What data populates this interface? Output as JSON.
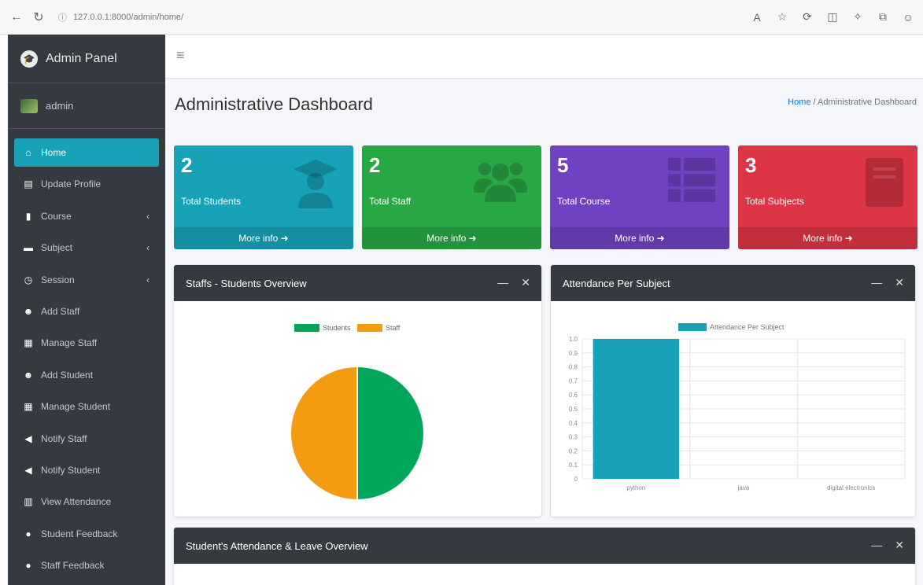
{
  "browser": {
    "url": "127.0.0.1:8000/admin/home/",
    "icons": [
      "read-aloud-icon",
      "favorite-star-icon",
      "refresh-icon",
      "split-screen-icon",
      "extensions-icon",
      "collections-icon",
      "profile-icon"
    ]
  },
  "sidebar": {
    "brand": "Admin Panel",
    "user": "admin",
    "items": [
      {
        "label": "Home",
        "icon": "home-icon",
        "active": true
      },
      {
        "label": "Update Profile",
        "icon": "id-card-icon"
      },
      {
        "label": "Course",
        "icon": "bookmark-icon",
        "chevron": true
      },
      {
        "label": "Subject",
        "icon": "book-icon",
        "chevron": true
      },
      {
        "label": "Session",
        "icon": "clock-icon",
        "chevron": true
      },
      {
        "label": "Add Staff",
        "icon": "user-plus-icon"
      },
      {
        "label": "Manage Staff",
        "icon": "table-icon"
      },
      {
        "label": "Add Student",
        "icon": "user-plus-icon"
      },
      {
        "label": "Manage Student",
        "icon": "table-icon"
      },
      {
        "label": "Notify Staff",
        "icon": "bullhorn-icon"
      },
      {
        "label": "Notify Student",
        "icon": "bullhorn-icon"
      },
      {
        "label": "View Attendance",
        "icon": "calendar-icon"
      },
      {
        "label": "Student Feedback",
        "icon": "comment-icon"
      },
      {
        "label": "Staff Feedback",
        "icon": "comment-icon"
      }
    ]
  },
  "header": {
    "title": "Administrative Dashboard",
    "breadcrumb_home": "Home",
    "breadcrumb_sep": "/",
    "breadcrumb_current": "Administrative Dashboard"
  },
  "stats": [
    {
      "value": "2",
      "label": "Total Students",
      "more": "More info",
      "color": "#17a2b8",
      "icon": "graduate-icon"
    },
    {
      "value": "2",
      "label": "Total Staff",
      "more": "More info",
      "color": "#28a745",
      "icon": "users-icon"
    },
    {
      "value": "5",
      "label": "Total Course",
      "more": "More info",
      "color": "#6f42c1",
      "icon": "th-list-icon"
    },
    {
      "value": "3",
      "label": "Total Subjects",
      "more": "More info",
      "color": "#dc3545",
      "icon": "book-icon"
    }
  ],
  "cards": {
    "pie_title": "Staffs - Students Overview",
    "bar_title": "Attendance Per Subject",
    "bottom_title": "Student's Attendance & Leave Overview"
  },
  "chart_data": [
    {
      "type": "pie",
      "categories": [
        "Students",
        "Staff"
      ],
      "values": [
        2,
        2
      ],
      "colors": [
        "#00a65a",
        "#f39c12"
      ],
      "legend_position": "top"
    },
    {
      "type": "bar",
      "categories": [
        "python",
        "java",
        "digital electronics"
      ],
      "series": [
        {
          "name": "Attendance Per Subject",
          "values": [
            1,
            0,
            0
          ],
          "color": "#17a2b8"
        }
      ],
      "ylim": [
        0,
        1
      ],
      "yticks": [
        "0",
        "0.1",
        "0.2",
        "0.3",
        "0.4",
        "0.5",
        "0.6",
        "0.7",
        "0.8",
        "0.9",
        "1.0"
      ],
      "legend_position": "top",
      "grid": true
    }
  ]
}
